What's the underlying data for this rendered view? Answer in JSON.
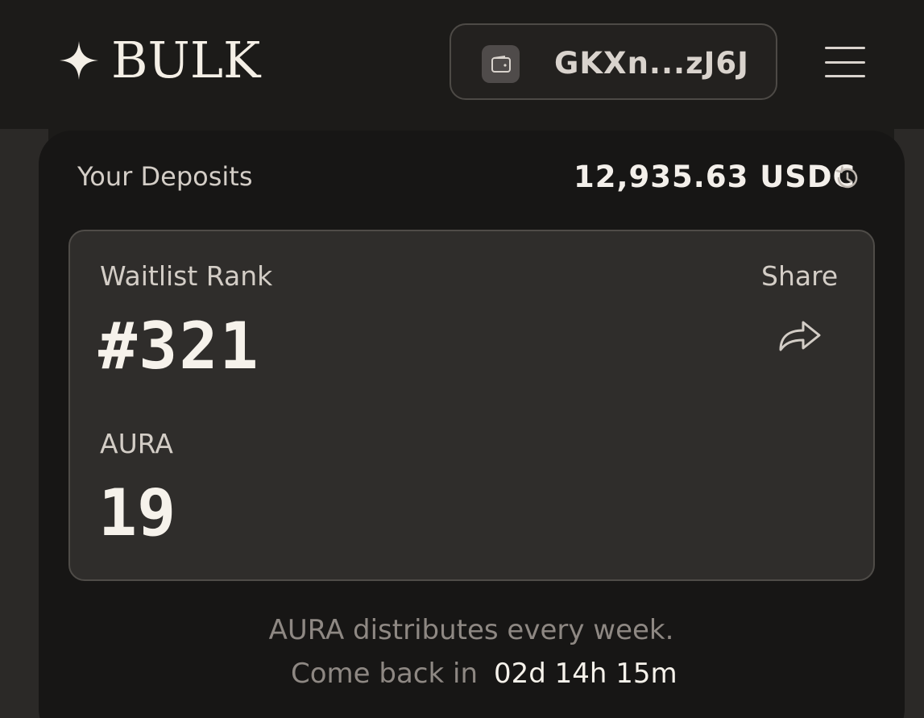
{
  "header": {
    "logo_text": "BULK",
    "wallet_address": "GKXn...zJ6J",
    "icons": {
      "logo": "sparkle-star-icon",
      "wallet": "wallet-icon",
      "menu": "hamburger-menu-icon"
    }
  },
  "deposits": {
    "label": "Your Deposits",
    "value": "12,935.63 USDC",
    "icon": "history-icon"
  },
  "waitlist": {
    "rank_label": "Waitlist Rank",
    "rank_value": "#321",
    "share_label": "Share",
    "share_icon": "share-arrow-icon",
    "aura_label": "AURA",
    "aura_value": "19"
  },
  "footer": {
    "line1": "AURA distributes every week.",
    "line2_prefix": "Come back in",
    "countdown": "02d 14h 15m"
  },
  "colors": {
    "background": "#1c1b19",
    "card": "#171615",
    "inner_box": "#2f2d2b",
    "text_primary": "#f6f2eb",
    "text_secondary": "#d3cdc6",
    "text_muted": "#8e8883"
  }
}
